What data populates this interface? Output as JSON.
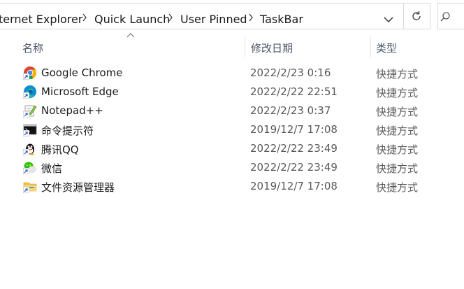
{
  "breadcrumb": {
    "items": [
      "ternet Explorer",
      "Quick Launch",
      "User Pinned",
      "TaskBar"
    ]
  },
  "columns": {
    "name": "名称",
    "date": "修改日期",
    "type": "类型"
  },
  "files": [
    {
      "name": "Google Chrome",
      "date": "2022/2/23 0:16",
      "type": "快捷方式",
      "icon": "chrome-icon"
    },
    {
      "name": "Microsoft Edge",
      "date": "2022/2/22 22:51",
      "type": "快捷方式",
      "icon": "edge-icon"
    },
    {
      "name": "Notepad++",
      "date": "2022/2/23 0:37",
      "type": "快捷方式",
      "icon": "notepadpp-icon"
    },
    {
      "name": "命令提示符",
      "date": "2019/12/7 17:08",
      "type": "快捷方式",
      "icon": "cmd-icon"
    },
    {
      "name": "腾讯QQ",
      "date": "2022/2/22 23:49",
      "type": "快捷方式",
      "icon": "qq-icon"
    },
    {
      "name": "微信",
      "date": "2022/2/22 23:49",
      "type": "快捷方式",
      "icon": "wechat-icon"
    },
    {
      "name": "文件资源管理器",
      "date": "2019/12/7 17:08",
      "type": "快捷方式",
      "icon": "file-explorer-icon"
    }
  ],
  "colors": {
    "border": "#d9d9d9",
    "header_text": "#4a5568",
    "secondary_text": "#5a5a5a"
  }
}
